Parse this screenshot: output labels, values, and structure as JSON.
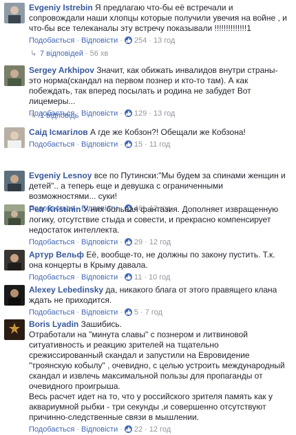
{
  "actions": {
    "like": "Подобається",
    "reply": "Відповісти",
    "dot": "·"
  },
  "comments": [
    {
      "author": "Evgeniy Istrebin",
      "text": "Я предлагаю что-бы её встречали и сопровождали наши хлопцы которые получили увечия на войне , и что-бы все телеканалы эту встречу показывали !!!!!!!!!!!!!!1",
      "likes": "254",
      "time": "13 год",
      "replies": {
        "label": "7 відповідей",
        "views": "56 хв"
      }
    },
    {
      "author": "Sergey Arkhipov",
      "text": "Значит, как обижать инвалидов внутри страны-это норма(скандал на первом познер и кто-то там). А как побеждать, так вперед посылать и родина не забудет Вот лицемеры...",
      "likes": "129",
      "time": "13 год",
      "replies": {
        "label": "1 відповідь",
        "views": ""
      }
    },
    {
      "author": "Саід Ісмагілов",
      "text": "А где же Кобзон?! Обещали же Кобзона!",
      "likes": "15",
      "time": "11 год"
    },
    {
      "author": "Evgeniy Lesnoy",
      "text": "все по Путински:\"Мы будем за спинами женщин и детей\".. а теперь еще и девушка с ограниченными возможностями... суки!",
      "likes": "46",
      "time": "12 год"
    },
    {
      "author": "Petr Kristinin",
      "text": "У них больная фантазия. Дополняет извращенную логику, отсутствие стыда и совести, и прекрасно компенсирует недостаток интеллекта.",
      "likes": "29",
      "time": "12 год"
    },
    {
      "author": "Артур Вельф",
      "text": "Её, вообще-то, не должны по закону пустить. Т.к. она концерты в Крыму давала.",
      "likes": "11",
      "time": "10 год"
    },
    {
      "author": "Alexey Lebedinsky",
      "text": "да, никакого блага от этого правящего клана ждать не приходится.",
      "likes": "5",
      "time": "7 год"
    },
    {
      "author": "Boris Lyadin",
      "text": "Зашибись.",
      "text2": "Отработали на \"минута славы\" с познером и литвиновой ситуативность и реакцию зрителей на тщательно срежиссированный скандал и запустили на Евровидение \"троянскую кобылу\" , очевидно, с целью устроить международный скандал и извлечь максимальной пользы для пропаганды от очевидного проигрыша.",
      "text3": "Весь расчет идет на то, что у российского зрителя память как у аквариумной рыбки - три секунды ,и совершенно отсутствуют причинно-следственные связи в мышлении.",
      "likes": "22",
      "time": "12 год"
    }
  ],
  "colors": {
    "link": "#365899",
    "action": "#4267b2",
    "muted": "#90949c",
    "like_badge": "#4267b2"
  }
}
